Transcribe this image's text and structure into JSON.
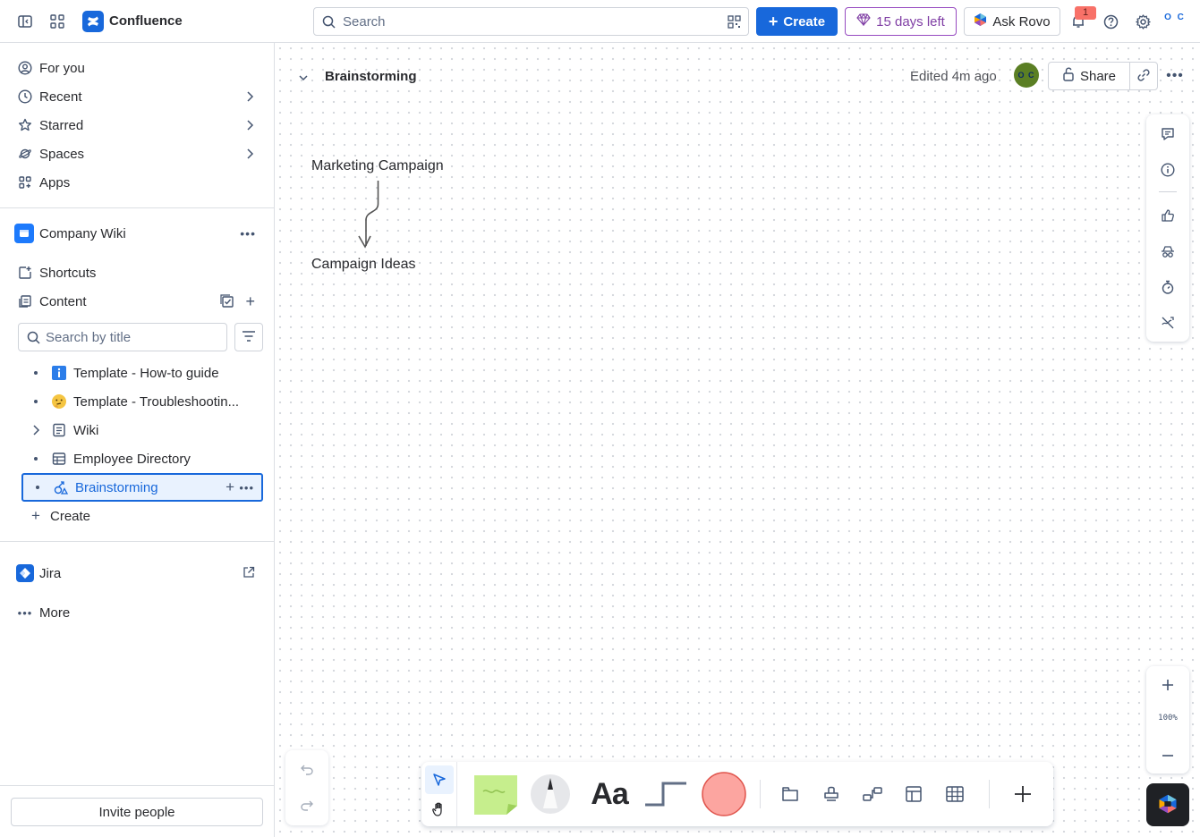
{
  "topbar": {
    "app_name": "Confluence",
    "search_placeholder": "Search",
    "create_label": "Create",
    "trial_label": "15 days left",
    "rovo_label": "Ask Rovo",
    "notification_count": "1",
    "user_initials": "O C"
  },
  "sidebar": {
    "nav": [
      {
        "label": "For you"
      },
      {
        "label": "Recent"
      },
      {
        "label": "Starred"
      },
      {
        "label": "Spaces"
      },
      {
        "label": "Apps"
      }
    ],
    "space_name": "Company Wiki",
    "shortcuts_label": "Shortcuts",
    "content_label": "Content",
    "search_placeholder": "Search by title",
    "tree": [
      {
        "label": "Template - How-to guide"
      },
      {
        "label": "Template - Troubleshootin..."
      },
      {
        "label": "Wiki"
      },
      {
        "label": "Employee Directory"
      },
      {
        "label": "Brainstorming"
      }
    ],
    "create_label": "Create",
    "jira_label": "Jira",
    "more_label": "More",
    "invite_label": "Invite people"
  },
  "page": {
    "title": "Brainstorming",
    "edited": "Edited 4m ago",
    "avatar_initials": "O C",
    "share_label": "Share"
  },
  "whiteboard": {
    "node_top": "Marketing Campaign",
    "node_bottom": "Campaign Ideas",
    "zoom": "100%",
    "text_tool": "Aa"
  },
  "colors": {
    "brand_blue": "#1868db",
    "trial_purple": "#803fa5",
    "sticky_green": "#c6ee8d",
    "shape_pink": "#fca5a0"
  }
}
